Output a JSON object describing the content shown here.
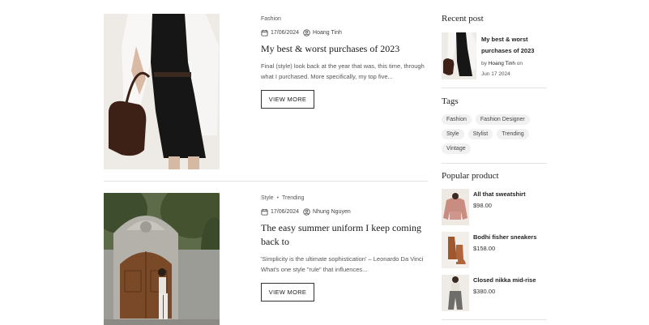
{
  "posts": [
    {
      "categories": [
        "Fashion"
      ],
      "date": "17/06/2024",
      "author": "Hoang Tinh",
      "title": "My best & worst purchases of 2023",
      "excerpt": "Final (style) look back at the year that was, this time, through what I purchased. More specifically, my top five...",
      "button": "VIEW MORE"
    },
    {
      "categories": [
        "Style",
        "Trending"
      ],
      "category_separator": "•",
      "date": "17/06/2024",
      "author": "Nhung Nguyen",
      "title": "The easy summer uniform I keep coming back to",
      "excerpt": "'Simplicity is the ultimate sophistication' – Leonardo Da Vinci What's one style \"rule\" that influences...",
      "button": "VIEW MORE"
    }
  ],
  "sidebar": {
    "recent": {
      "heading": "Recent post",
      "title": "My best & worst purchases of 2023",
      "by": "by",
      "author": "Hoang Tinh",
      "on": "on",
      "date": "Jun 17 2024"
    },
    "tags": {
      "heading": "Tags",
      "items": [
        "Fashion",
        "Fashion Designer",
        "Style",
        "Stylist",
        "Trending",
        "Vintage"
      ]
    },
    "popular": {
      "heading": "Popular product",
      "items": [
        {
          "name": "All that sweatshirt",
          "price": "$98.00"
        },
        {
          "name": "Bodhi fisher sneakers",
          "price": "$158.00"
        },
        {
          "name": "Closed nikka mid-rise",
          "price": "$380.00"
        }
      ]
    }
  },
  "icons": {
    "calendar": "calendar-icon",
    "user": "user-circle-icon"
  },
  "colors": {
    "text": "#222222",
    "muted": "#555555",
    "tag_bg": "#f1f1f1",
    "rule": "#e3e3e3"
  }
}
